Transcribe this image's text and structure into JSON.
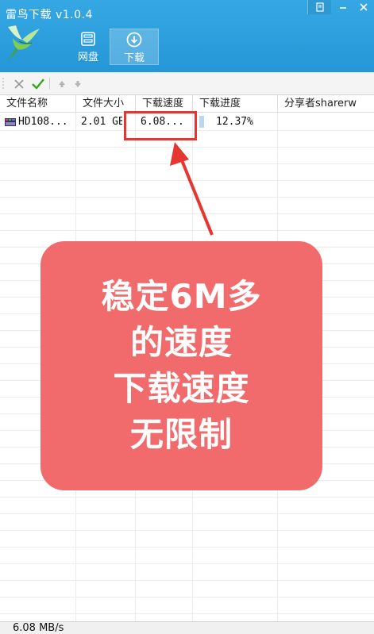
{
  "app": {
    "title": "雷鸟下载 v1.0.4"
  },
  "window_controls": {
    "restore_icon": "restore-icon",
    "minimize_icon": "minimize-icon",
    "close_icon": "close-icon"
  },
  "nav": {
    "tabs": [
      {
        "label": "网盘",
        "icon": "disk-icon",
        "selected": false
      },
      {
        "label": "下载",
        "icon": "download-icon",
        "selected": true
      }
    ]
  },
  "toolbar": {
    "items": [
      "delete-icon",
      "confirm-icon",
      "move-up-icon",
      "move-down-icon"
    ]
  },
  "table": {
    "columns": [
      "文件名称",
      "文件大小",
      "下载速度",
      "下载进度",
      "分享者sharerw"
    ],
    "rows": [
      {
        "name": "HD108...",
        "size": "2.01 GB",
        "speed": "6.08...",
        "progress": "12.37%",
        "progress_fraction": 0.1237,
        "sharer": ""
      }
    ]
  },
  "callout": {
    "lines": [
      "稳定6M多",
      "的速度",
      "下载速度",
      "无限制"
    ]
  },
  "colors": {
    "header": "#2596d6",
    "callout_bg": "#f26b6c",
    "highlight": "#e63631",
    "confirm_green": "#3aa61a"
  },
  "status": {
    "speed": "6.08 MB/s"
  }
}
